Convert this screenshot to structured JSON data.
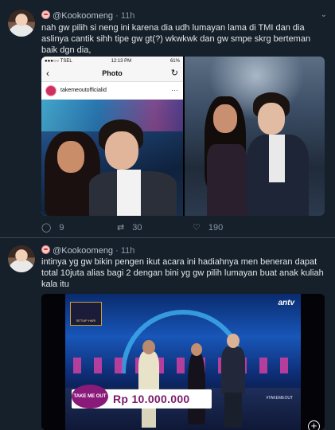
{
  "tweets": [
    {
      "handle": "@Kookoomeng",
      "separator": "·",
      "time": "11h",
      "text": "nah gw pilih si neng ini karena dia udh lumayan lama di TMI dan dia aslinya cantik sihh tipe gw gt(?) wkwkwk dan gw smpe skrg berteman baik dgn dia,",
      "replies": "9",
      "retweets": "30",
      "likes": "190",
      "phone": {
        "carrier": "●●●○○ TSEL",
        "clock": "12:13 PM",
        "battery": "61%",
        "title": "Photo",
        "account": "takemeoutofficialid"
      }
    },
    {
      "handle": "@Kookoomeng",
      "separator": "·",
      "time": "11h",
      "text": "intinya yg gw bikin pengen ikut acara ini hadiahnya men beneran dapat total 10juta alias bagi 2 dengan bini yg gw pilih lumayan buat anak kuliah kala itu",
      "video": {
        "channel": "antv",
        "price": "Rp 10.000.000",
        "show_logo": "TAKE ME OUT",
        "hashtag": "#TAKEMEOUT",
        "badge": "SETIAP HARI"
      }
    }
  ],
  "icons": {
    "reply": "comment-icon",
    "retweet": "retweet-icon",
    "like": "heart-icon",
    "more": "chevron-down-icon",
    "expand": "plus-icon"
  },
  "colors": {
    "background": "#15202b",
    "text": "#e6e6e6",
    "muted": "#8899a6",
    "divider": "#38444d"
  }
}
